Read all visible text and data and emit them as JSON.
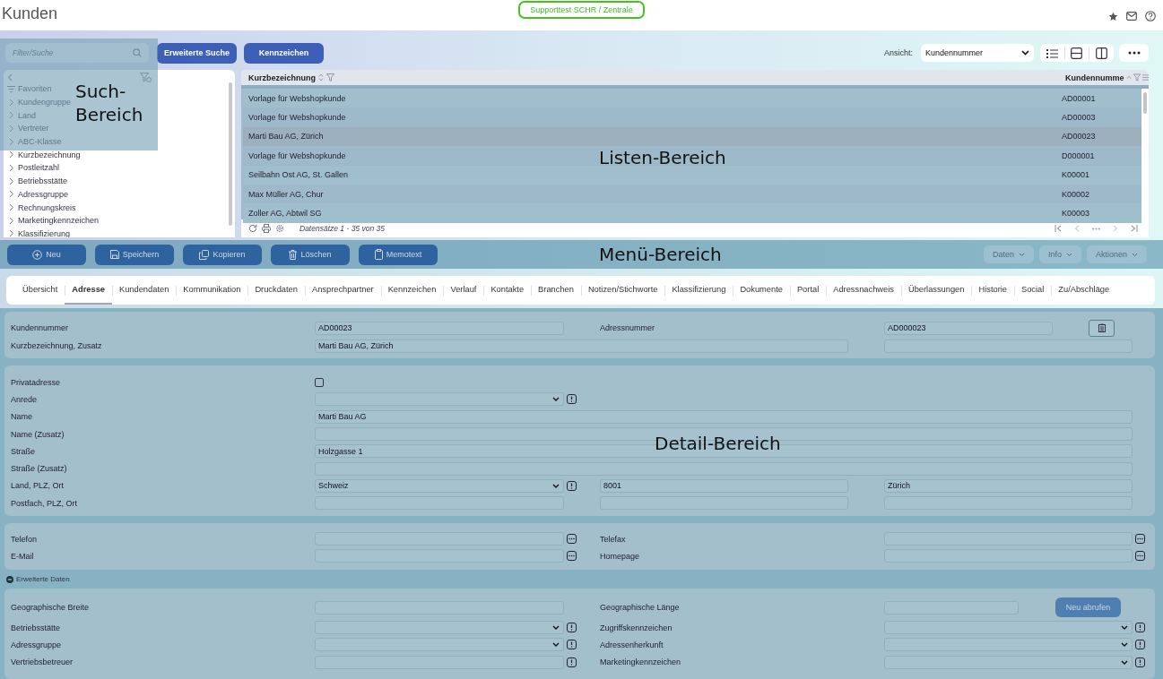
{
  "window": {
    "title": "Kunden"
  },
  "context_badge": "Supporttest SCHR / Zentrale",
  "search": {
    "placeholder": "Filter/Suche"
  },
  "toolbar_buttons": [
    "Erweiterte Suche",
    "Kennzeichen"
  ],
  "view": {
    "label": "Ansicht:",
    "value": "Kundennummer"
  },
  "tree": {
    "items": [
      {
        "kind": "filter",
        "label": "Favoriten"
      },
      {
        "kind": "group",
        "label": "Kundengruppe"
      },
      {
        "kind": "group",
        "label": "Land"
      },
      {
        "kind": "group",
        "label": "Vertreter"
      },
      {
        "kind": "group",
        "label": "ABC-Klasse"
      },
      {
        "kind": "group",
        "label": "Kurzbezeichnung"
      },
      {
        "kind": "group",
        "label": "Postleitzahl"
      },
      {
        "kind": "group",
        "label": "Betriebsstätte"
      },
      {
        "kind": "group",
        "label": "Adressgruppe"
      },
      {
        "kind": "group",
        "label": "Rechnungskreis"
      },
      {
        "kind": "group",
        "label": "Marketingkennzeichen"
      },
      {
        "kind": "group",
        "label": "Klassifizierung"
      }
    ]
  },
  "list": {
    "columns": [
      "Kurzbezeichnung",
      "Kundennumme"
    ],
    "rows": [
      {
        "cells": [
          "Vorlage für Webshopkunde",
          "AD00001"
        ],
        "selected": false
      },
      {
        "cells": [
          "Vorlage für Webshopkunde",
          "AD00003"
        ],
        "selected": false
      },
      {
        "cells": [
          "Marti Bau AG, Zürich",
          "AD00023"
        ],
        "selected": true
      },
      {
        "cells": [
          "Vorlage für Webshopkunde",
          "D000001"
        ],
        "selected": false
      },
      {
        "cells": [
          "Seilbahn Ost AG, St. Gallen",
          "K00001"
        ],
        "selected": false
      },
      {
        "cells": [
          "Max Müller AG, Chur",
          "K00002"
        ],
        "selected": false
      },
      {
        "cells": [
          "Zoller AG, Abtwil SG",
          "K00003"
        ],
        "selected": false
      }
    ],
    "footer": "Datensätze 1 - 35 von 35"
  },
  "menu": {
    "actions": [
      {
        "kind": "new",
        "label": "Neu"
      },
      {
        "kind": "save",
        "label": "Speichern"
      },
      {
        "kind": "copy",
        "label": "Kopieren"
      },
      {
        "kind": "delete",
        "label": "Löschen"
      },
      {
        "kind": "memo",
        "label": "Memotext"
      }
    ],
    "dropdowns": [
      "Daten",
      "Info",
      "Aktionen"
    ]
  },
  "tabs": [
    {
      "label": "Übersicht",
      "selected": false
    },
    {
      "label": "Adresse",
      "selected": true
    },
    {
      "label": "Kundendaten",
      "selected": false
    },
    {
      "label": "Kommunikation",
      "selected": false
    },
    {
      "label": "Druckdaten",
      "selected": false
    },
    {
      "label": "Ansprechpartner",
      "selected": false
    },
    {
      "label": "Kennzeichen",
      "selected": false
    },
    {
      "label": "Verlauf",
      "selected": false
    },
    {
      "label": "Kontakte",
      "selected": false
    },
    {
      "label": "Branchen",
      "selected": false
    },
    {
      "label": "Notizen/Stichworte",
      "selected": false
    },
    {
      "label": "Klassifizierung",
      "selected": false
    },
    {
      "label": "Dokumente",
      "selected": false
    },
    {
      "label": "Portal",
      "selected": false
    },
    {
      "label": "Adressnachweis",
      "selected": false
    },
    {
      "label": "Überlassungen",
      "selected": false
    },
    {
      "label": "Historie",
      "selected": false
    },
    {
      "label": "Social",
      "selected": false
    },
    {
      "label": "Zu/Abschläge",
      "selected": false
    }
  ],
  "detail": {
    "sections": [
      {
        "kind": "fields",
        "rows": [
          {
            "kind": "id",
            "label": "Kundennummer",
            "value": "AD00023",
            "label2": "Adressnummer",
            "value2": "AD000023"
          },
          {
            "kind": "short-wide",
            "label": "Kurzbezeichnung, Zusatz",
            "value": "Marti Bau AG, Zürich"
          }
        ]
      },
      {
        "kind": "fields",
        "rows": [
          {
            "kind": "checkbox",
            "label": "Privatadresse",
            "checked": false
          },
          {
            "kind": "select",
            "label": "Anrede"
          },
          {
            "kind": "text",
            "label": "Name",
            "value": "Marti Bau AG"
          },
          {
            "kind": "text",
            "label": "Name (Zusatz)"
          },
          {
            "kind": "text",
            "label": "Straße",
            "value": "Holzgasse 1"
          },
          {
            "kind": "text",
            "label": "Straße (Zusatz)"
          },
          {
            "kind": "select-address",
            "label": "Land, PLZ, Ort",
            "value": "Schweiz",
            "value2": "8001",
            "value3": "Zürich"
          },
          {
            "kind": "address",
            "label": "Postfach, PLZ, Ort"
          }
        ]
      },
      {
        "kind": "fields",
        "rows": [
          {
            "kind": "contact",
            "label": "Telefon",
            "label2": "Telefax"
          },
          {
            "kind": "contact",
            "label": "E-Mail",
            "label2": "Homepage"
          }
        ]
      },
      {
        "kind": "header",
        "label": "Erweiterte Daten",
        "expanded": true
      },
      {
        "kind": "fields",
        "rows": [
          {
            "kind": "geo",
            "label": "Geographische Breite",
            "label2": "Geographische Länge",
            "button": "Neu abrufen"
          },
          {
            "kind": "select-pair",
            "label": "Betriebsstätte",
            "label2": "Zugriffskennzeichen"
          },
          {
            "kind": "select-pair",
            "label": "Adressgruppe",
            "label2": "Adressenherkunft"
          },
          {
            "kind": "input-select",
            "label": "Vertriebsbetreuer",
            "label2": "Marketingkennzeichen"
          }
        ]
      }
    ]
  },
  "annotations": [
    {
      "kind": "search-area",
      "label": "Such-Bereich"
    },
    {
      "kind": "list-area",
      "label": "Listen-Bereich"
    },
    {
      "kind": "menu-area",
      "label": "Menü-Bereich"
    },
    {
      "kind": "detail-area",
      "label": "Detail-Bereich"
    }
  ]
}
